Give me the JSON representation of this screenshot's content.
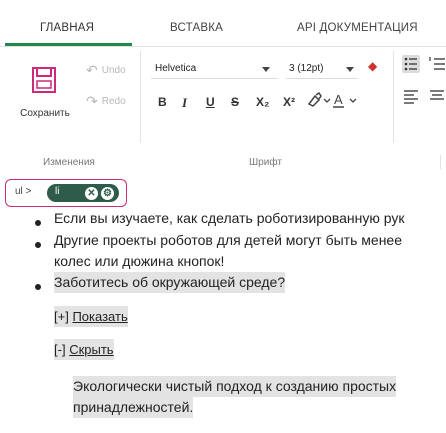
{
  "tabs": [
    {
      "label": "ГЛАВНАЯ"
    },
    {
      "label": "ВСТАВКА"
    },
    {
      "label": "API ДОКУМЕНТАЦИЯ"
    }
  ],
  "ribbon": {
    "save_label": "Сохранить",
    "undo_label": "Undo",
    "redo_label": "Redo",
    "font_family": "Helvetica",
    "font_size": "3 (12pt)",
    "format_buttons": [
      "B",
      "I",
      "U",
      "S",
      "X₂",
      "X²"
    ],
    "groups": {
      "edit": "Изменения",
      "font": "Шрифт"
    }
  },
  "breadcrumb": {
    "parent": "ul",
    "separator": ">",
    "current": "li"
  },
  "document": {
    "items": [
      {
        "text": "Если вы изучаете, как сделать роботизированную рук"
      },
      {
        "text_lines": [
          "Другие проекты роботов для детей могут быть менее",
          "колес или дюжина кнопок!"
        ]
      },
      {
        "text": "Заботитесь об окружающей среде?"
      }
    ],
    "show_toggle": {
      "prefix": "[+]",
      "link": "Показать"
    },
    "hide_toggle": {
      "prefix": "[-]",
      "link": "Скрыть"
    },
    "paragraph_lines": [
      "Экологически чистый подход к созданию простых",
      "принадлежностей."
    ]
  },
  "colors": {
    "tab_accent": "#1f8a4c",
    "breadcrumb_border": "#cc2a7a",
    "breadcrumb_pill": "#2e5b4a",
    "highlight": "#e3e3e3"
  }
}
